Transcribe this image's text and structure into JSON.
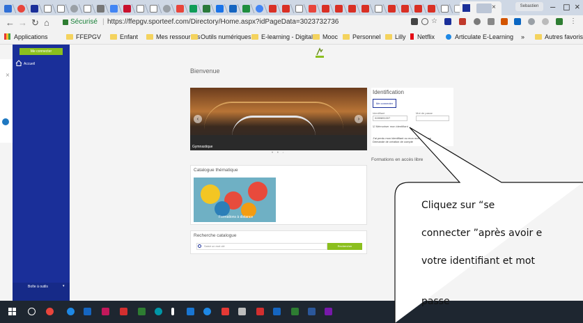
{
  "browser": {
    "window_controls": [
      "–",
      "◻",
      "×"
    ],
    "secure_label": "Sécurisé",
    "url": "https://ffepgv.sporteef.com/Directory/Home.aspx?idPageData=3023732736",
    "profile_label": "Sebastien"
  },
  "bookmarks": {
    "apps_label": "Applications",
    "items": [
      "FFEPGV",
      "Enfant",
      "Mes ressources",
      "Outils numériques",
      "E-learning - Digital",
      "Mooc",
      "Personnel",
      "Lilly",
      "Netflix",
      "Articulate E-Learning"
    ],
    "more": "»",
    "other": "Autres favoris"
  },
  "sidebar": {
    "connect_label": "Me connecter",
    "home_label": "Accueil",
    "bottom_label": "Boîte à outils"
  },
  "main": {
    "welcome": "Bienvenue",
    "banner_caption": "Gymnastique",
    "identification": {
      "title": "Identification",
      "connect_button": "Me connecter",
      "login_label": "Identifiant",
      "login_value": "0289891007",
      "password_label": "Mot de passe",
      "remember_label": "Mémoriser mon identifiant",
      "forgot_label": "J'ai perdu mon identifiant ou mon mot de passe",
      "request_label": "Demande de création de compte"
    },
    "free_access": "Formations en accès libre",
    "catalog_title": "Catalogue thématique",
    "catalog_caption": "Formations à distance",
    "search_title": "Recherche catalogue",
    "search_placeholder": "Saisir un mot clé",
    "search_button": "Rechercher"
  },
  "callout": {
    "lines": [
      "Cliquez sur “se",
      "connecter ”après avoir e",
      "votre identifiant et mot",
      "passe"
    ]
  },
  "colors": {
    "sidebar": "#1a2f99",
    "accent_green": "#8bbf1e",
    "taskbar": "#1e2630"
  }
}
